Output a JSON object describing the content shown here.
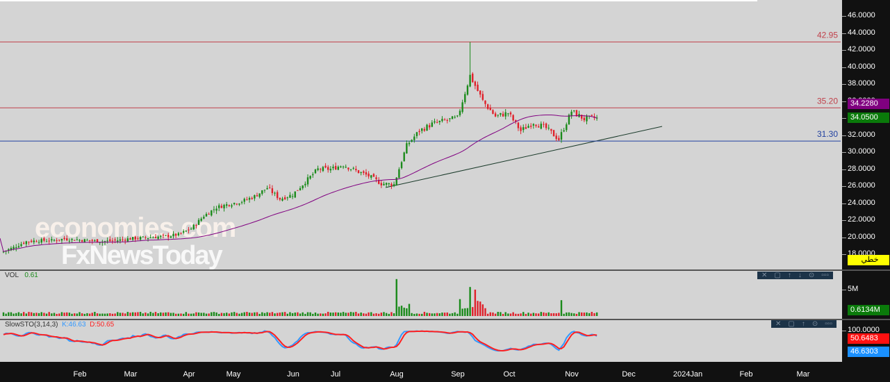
{
  "price_axis": [
    "46.0000",
    "44.0000",
    "42.0000",
    "40.0000",
    "38.0000",
    "36.0000",
    "34.0000",
    "32.0000",
    "30.0000",
    "28.0000",
    "26.0000",
    "24.0000",
    "22.0000",
    "20.0000",
    "18.0000"
  ],
  "levels": [
    {
      "label": "42.95",
      "value": 42.95,
      "color": "#c0404a"
    },
    {
      "label": "35.20",
      "value": 35.2,
      "color": "#c0404a"
    },
    {
      "label": "31.30",
      "value": 31.3,
      "color": "#2040a0"
    }
  ],
  "tags": {
    "ma": "34.2280",
    "last": "34.0500",
    "vol": "0.6134M",
    "d": "50.6483",
    "k": "46.6303",
    "linear": "خطي"
  },
  "vol_panel": {
    "name": "VOL",
    "value": "0.61",
    "axis": "5M"
  },
  "sto_panel": {
    "name": "SlowSTO(3,14,3)",
    "k": "K:46.63",
    "d": "D:50.65",
    "axis": "100.0000"
  },
  "toolbar_icons": [
    "✕",
    "▢",
    "↑",
    "↓",
    "⊙",
    "▫▫▫"
  ],
  "months": [
    "Feb",
    "Mar",
    "Apr",
    "May",
    "Jun",
    "Jul",
    "Aug",
    "Sep",
    "Oct",
    "Nov",
    "Dec",
    "2024Jan",
    "Feb",
    "Mar"
  ],
  "watermark": [
    "economies.com",
    "FxNewsToday"
  ],
  "colors": {
    "up": "#1a8a1a",
    "down": "#e0202a",
    "ma": "#800080",
    "k": "#3399ff",
    "d": "#ff2020"
  },
  "chart_data": {
    "type": "candlestick",
    "ylim": [
      16.5,
      47
    ],
    "weekly_close": [
      18.2,
      18.8,
      19.5,
      19.6,
      19.6,
      19.8,
      19.7,
      19.6,
      19.5,
      19.6,
      19.8,
      19.9,
      20.0,
      20.1,
      20.3,
      21,
      22.5,
      23.5,
      23.9,
      24.2,
      24.8,
      25.8,
      24.5,
      25,
      26.5,
      28,
      28,
      28.5,
      27.8,
      27.2,
      26.3,
      26.2,
      30.8,
      32.5,
      33.3,
      33.7,
      34,
      39,
      36,
      34.2,
      34.6,
      32.5,
      33.5,
      32.8,
      31.5,
      34.8,
      33.9,
      34.05
    ]
  }
}
